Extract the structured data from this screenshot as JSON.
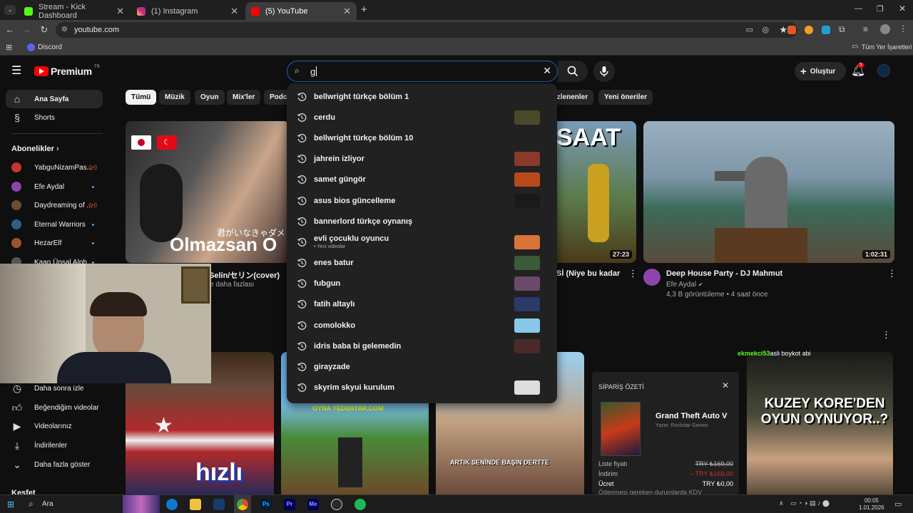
{
  "browser": {
    "tabs": [
      {
        "title": "Stream - Kick Dashboard",
        "color": "#53fc18"
      },
      {
        "title": "(1) Instagram",
        "color": "#e1306c"
      },
      {
        "title": "(5) YouTube",
        "color": "#ff0000"
      }
    ],
    "url": "youtube.com",
    "bookmarks": {
      "discord": "Discord",
      "all_bookmarks": "Tüm Yer İşaretleri"
    }
  },
  "youtube": {
    "logo": "Premium",
    "logo_sup": "TR",
    "search_value": "g",
    "create_label": "Oluştur",
    "notif_count": "5",
    "sidebar": {
      "home": "Ana Sayfa",
      "shorts": "Shorts",
      "subs_title": "Abonelikler",
      "subs": [
        {
          "name": "YabguNizamPas...",
          "color": "#c0392b",
          "status": "live"
        },
        {
          "name": "Efe Aydal",
          "color": "#8e44ad",
          "status": "new"
        },
        {
          "name": "Daydreaming of ...",
          "color": "#6d4c2f",
          "status": "live"
        },
        {
          "name": "Eternal Warriors",
          "color": "#2c5f8a",
          "status": "new"
        },
        {
          "name": "HezarElf",
          "color": "#a0522d",
          "status": "new"
        },
        {
          "name": "Kaan Ünsal Alph...",
          "color": "#555555",
          "status": "new"
        }
      ],
      "watch_later": "Daha sonra izle",
      "liked": "Beğendiğim videolar",
      "your_videos": "Videolarınız",
      "downloads": "İndirilenler",
      "show_more": "Daha fazla göster",
      "explore": "Keşfet"
    },
    "chips": [
      "Tümü",
      "Müzik",
      "Oyun",
      "Mix'ler",
      "Podca",
      "izlenenler",
      "Yeni öneriler"
    ],
    "suggestions": [
      {
        "text": "bellwright türkçe bölüm 1",
        "thumb": ""
      },
      {
        "text": "cerdu",
        "thumb": "#4a4a2a"
      },
      {
        "text": "bellwright türkçe bölüm 10",
        "thumb": ""
      },
      {
        "text": "jahrein izliyor",
        "thumb": "#8a3a2a"
      },
      {
        "text": "samet güngör",
        "thumb": "#b84a1a"
      },
      {
        "text": "asus bios güncelleme",
        "thumb": "#1a1a1a"
      },
      {
        "text": "bannerlord türkçe oynanış",
        "thumb": ""
      },
      {
        "text": "evli çocuklu oyuncu",
        "thumb": "#d8743a",
        "sub": "• Yeni videolar"
      },
      {
        "text": "enes batur",
        "thumb": "#3a5a3a"
      },
      {
        "text": "fubgun",
        "thumb": "#6a4a6a"
      },
      {
        "text": "fatih altaylı",
        "thumb": "#2a3a6a"
      },
      {
        "text": "comolokko",
        "thumb": "#88c8e8"
      },
      {
        "text": "idris baba bi gelemedin",
        "thumb": "#4a2a2a"
      },
      {
        "text": "girayzade",
        "thumb": ""
      },
      {
        "text": "skyrim skyui kurulum",
        "thumb": "#dddddd"
      }
    ],
    "videos": {
      "v1": {
        "overlay_jp": "君がいなきゃダメ",
        "overlay_big": "Olmazsan O",
        "title_partial": "Selin/セリン(cover)",
        "channel_partial": "e daha fazlası"
      },
      "v2": {
        "overlay": "SAAT",
        "duration": "27:23",
        "title_partial": "Sİ (Niye bu kadar"
      },
      "v3": {
        "title": "Deep House Party - DJ Mahmut",
        "channel": "Efe Aydal",
        "meta": "4,3 B görüntüleme • 4 saat önce",
        "duration": "1:02:31"
      },
      "row2": {
        "v_hizli": "hızlı",
        "v_mc_banner": "OYNA YEDIDIYAR.COM",
        "v_old_caption": "ARTIK SENİNDE BAŞIN DERTTE",
        "v_korea": "KUZEY KORE'DEN OYUN OYNUYOR..?"
      }
    },
    "chat_overlay": {
      "user": "ekmekci53",
      "message": "asli boykot abi"
    }
  },
  "order_summary": {
    "title": "SİPARİŞ ÖZETİ",
    "game": "Grand Theft Auto V",
    "publisher": "Yazar: Rockstar Games",
    "rows": [
      {
        "label": "Liste fiyatı",
        "value": "TRY ₺169,00"
      },
      {
        "label": "İndirim",
        "value": "– TRY ₺169,00"
      },
      {
        "label": "Ücret",
        "value": "TRY ₺0,00"
      }
    ],
    "footer": "Ödenmesi gereken durumlarda KDV"
  },
  "taskbar": {
    "search": "Ara",
    "time": "00:05",
    "date": "1.01.2026"
  }
}
